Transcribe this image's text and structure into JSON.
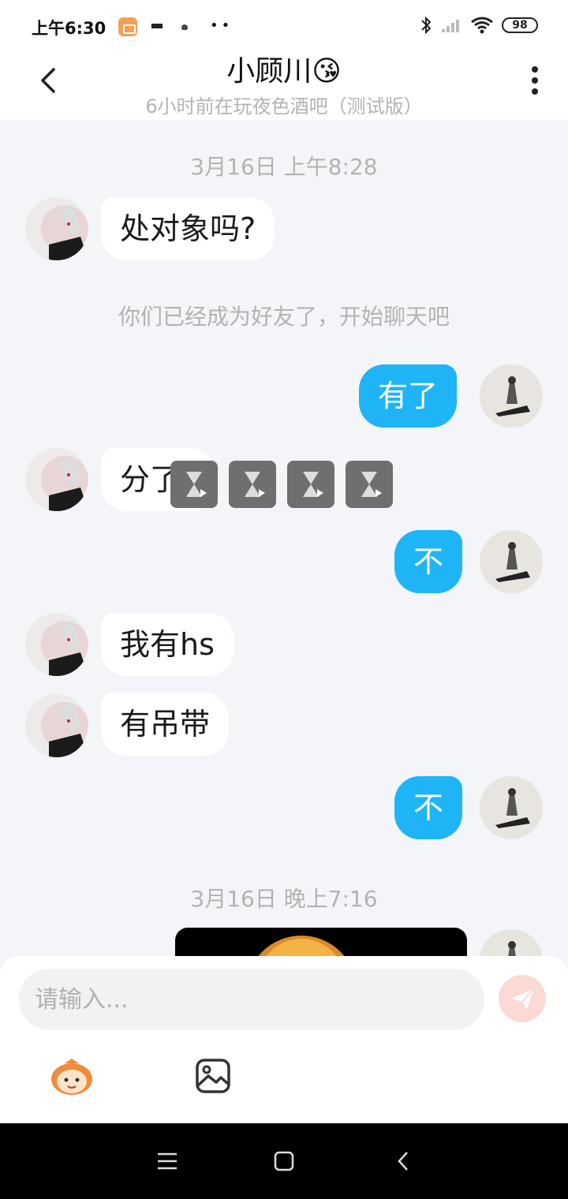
{
  "status_bar": {
    "time": "上午6:30",
    "battery": "98"
  },
  "header": {
    "title": "小顾川😘",
    "subtitle": "6小时前在玩夜色酒吧（测试版）"
  },
  "messages": {
    "ts1": "3月16日 上午8:28",
    "m1": "处对象吗?",
    "system": "你们已经成为好友了，开始聊天吧",
    "m2": "有了",
    "m3": "分了?",
    "m4": "不",
    "m5": "我有hs",
    "m6": "有吊带",
    "m7": "不",
    "ts2": "3月16日 晚上7:16"
  },
  "input": {
    "placeholder": "请输入..."
  },
  "icons": [
    "back-arrow-icon",
    "more-vertical-icon",
    "send-icon",
    "emoji-icon",
    "image-icon",
    "menu-icon",
    "home-icon",
    "back-icon"
  ],
  "colors": {
    "accent_blue": "#1fb4f5",
    "background": "#f3f5f8",
    "send_pink": "#fbd9d4"
  }
}
